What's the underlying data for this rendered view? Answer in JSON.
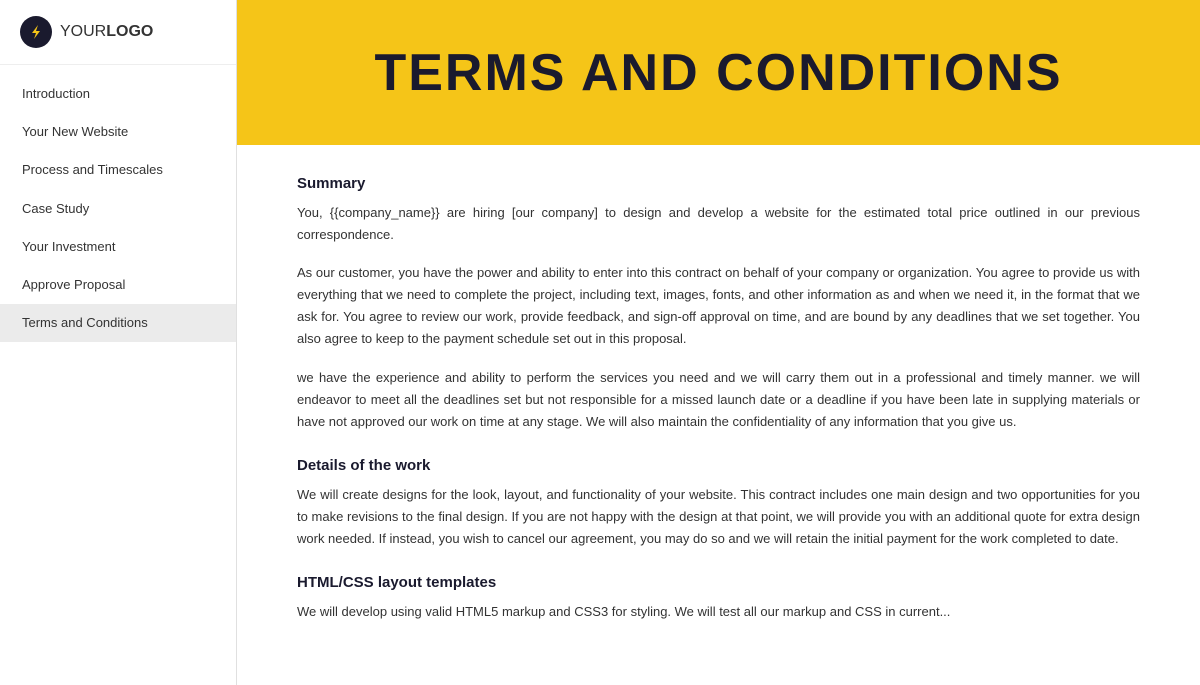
{
  "logo": {
    "icon_label": "lightning-bolt-icon",
    "text_prefix": "YOUR",
    "text_suffix": "LOGO"
  },
  "sidebar": {
    "nav_items": [
      {
        "label": "Introduction",
        "active": false
      },
      {
        "label": "Your New Website",
        "active": false
      },
      {
        "label": "Process and Timescales",
        "active": false
      },
      {
        "label": "Case Study",
        "active": false
      },
      {
        "label": "Your Investment",
        "active": false
      },
      {
        "label": "Approve Proposal",
        "active": false
      },
      {
        "label": "Terms and Conditions",
        "active": true
      }
    ]
  },
  "hero": {
    "title": "TERMS AND CONDITIONS"
  },
  "content": {
    "sections": [
      {
        "heading": "Summary",
        "paragraphs": [
          "You, {{company_name}} are hiring [our company] to design and develop a website for the estimated total price outlined in our previous correspondence.",
          "As our customer, you have the power and ability to enter into this contract on behalf of your company or organization. You agree to provide us with everything that we need to complete the project, including text, images, fonts, and other information as and when we need it, in the format that we ask for. You agree to review our work, provide feedback, and sign-off approval on time, and are bound by any deadlines that we set together. You also agree to keep to the payment schedule set out in this proposal.",
          "we have the experience and ability to perform the services you need and we will carry them out in a professional and timely manner. we will endeavor to meet all the deadlines set but not responsible for a missed launch date or a deadline if you have been late in supplying materials or have not approved our work on time at any stage. We will also maintain the confidentiality of any information that you give us."
        ]
      },
      {
        "heading": "Details of the work",
        "paragraphs": [
          "We will create designs for the look, layout, and functionality of your website. This contract includes one main design and two opportunities for you to make revisions to the final design. If you are not happy with the design at that point, we will provide you with an additional quote for extra design work needed. If instead, you wish to cancel our agreement, you may do so and we will retain the initial payment for the work completed to date."
        ]
      },
      {
        "heading": "HTML/CSS layout templates",
        "paragraphs": [
          "We will develop using valid HTML5 markup and CSS3 for styling. We will test all our markup and CSS in current..."
        ]
      }
    ]
  }
}
